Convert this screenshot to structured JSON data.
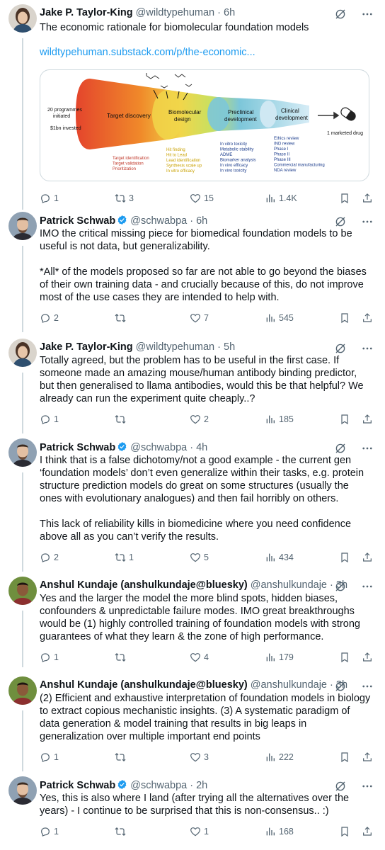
{
  "tweets": [
    {
      "name": "Jake P. Taylor-King",
      "handle": "@wildtypehuman",
      "time": "· 6h",
      "verified": false,
      "text": "The economic rationale for biomolecular foundation models",
      "link": "wildtypehuman.substack.com/p/the-economic...",
      "replies": "1",
      "reposts": "3",
      "likes": "15",
      "views": "1.4K"
    },
    {
      "name": "Patrick Schwab",
      "handle": "@schwabpa",
      "time": "· 6h",
      "verified": true,
      "text": "IMO the critical missing piece for biomedical foundation models to be useful is not data, but generalizability.\n\n*All* of the models proposed so far are not able to go beyond the biases of their own training data - and crucially because of this, do not improve most of the use cases they are intended to help with.",
      "replies": "2",
      "reposts": "",
      "likes": "7",
      "views": "545"
    },
    {
      "name": "Jake P. Taylor-King",
      "handle": "@wildtypehuman",
      "time": "· 5h",
      "verified": false,
      "text": "Totally agreed, but the problem has to be useful in the first case. If someone made an amazing mouse/human antibody binding predictor, but then generalised to llama antibodies, would this be that helpful? We already can run the experiment quite cheaply..?",
      "replies": "1",
      "reposts": "",
      "likes": "2",
      "views": "185"
    },
    {
      "name": "Patrick Schwab",
      "handle": "@schwabpa",
      "time": "· 4h",
      "verified": true,
      "text": "I think that is a false dichotomy/not a good example - the current gen ‘foundation models’ don’t even generalize within their tasks, e.g. protein structure prediction models do great on some structures (usually the ones with evolutionary analogues) and then fail horribly on others.\n\nThis lack of reliability kills in biomedicine where you need confidence above all as you can’t verify the results.",
      "replies": "2",
      "reposts": "1",
      "likes": "5",
      "views": "434"
    },
    {
      "name": "Anshul Kundaje (anshulkundaje@bluesky)",
      "handle": "@anshulkundaje",
      "time": "· 3h",
      "verified": false,
      "text": "Yes and the larger the model the more blind spots, hidden biases, confounders & unpredictable failure modes. IMO great breakthroughs would be (1) highly controlled training of foundation models with strong guarantees of what they learn & the zone of high performance.",
      "replies": "1",
      "reposts": "",
      "likes": "4",
      "views": "179"
    },
    {
      "name": "Anshul Kundaje (anshulkundaje@bluesky)",
      "handle": "@anshulkundaje",
      "time": "· 3h",
      "verified": false,
      "text": "(2) Efficient and exhaustive interpretation of foundation models in biology to extract copious mechanistic insights. (3) A systematic paradigm of data generation & model training that results in big leaps in generalization over multiple important end points",
      "replies": "1",
      "reposts": "",
      "likes": "3",
      "views": "222"
    },
    {
      "name": "Patrick Schwab",
      "handle": "@schwabpa",
      "time": "· 2h",
      "verified": true,
      "text": "Yes, this is also where I land (after trying all the alternatives over the years) - I continue to be surprised that this is non-consensus.. :)",
      "replies": "1",
      "reposts": "",
      "likes": "1",
      "views": "168"
    }
  ],
  "figure": {
    "left_top": "20 programmes",
    "left_mid": "initiated",
    "left_bot": "$1bn invested",
    "stage1": "Target discovery",
    "stage2a": "Biomolecular",
    "stage2b": "design",
    "stage3a": "Preclinical",
    "stage3b": "development",
    "stage4a": "Clinical",
    "stage4b": "development",
    "result": "1 marketed drug",
    "list1": [
      "Target identification",
      "Target validation",
      "Prioritization"
    ],
    "list2": [
      "Hit finding",
      "Hit to Lead",
      "Lead identification",
      "Synthesis scale up",
      "In vitro efficacy"
    ],
    "list3": [
      "In vitro toxicity",
      "Metabolic stability",
      "ADME",
      "Biomarker analysis",
      "In vivo efficacy",
      "In vivo toxicity"
    ],
    "list4": [
      "Ethics review",
      "IND review",
      "Phase I",
      "Phase II",
      "Phase III",
      "Commercial manufacturing",
      "NDA review"
    ]
  },
  "colors": {
    "text_primary": "#0f1419",
    "text_secondary": "#536471",
    "link": "#1d9bf0",
    "verified": "#1d9bf0",
    "stage1": "#e4452c",
    "stage2": "#f1d64a",
    "stage3": "#7cc6d9",
    "stage4": "#cfe8f3",
    "list1": "#c0392b",
    "list2": "#c9a100",
    "list3": "#1c3d8c",
    "list4": "#1c3d8c"
  },
  "icons": [
    "reply-icon",
    "repost-icon",
    "like-icon",
    "views-icon",
    "bookmark-icon",
    "share-icon",
    "grok-icon",
    "more-icon",
    "verified-icon",
    "pill-icon",
    "arrow-icon",
    "molecule-icon"
  ]
}
